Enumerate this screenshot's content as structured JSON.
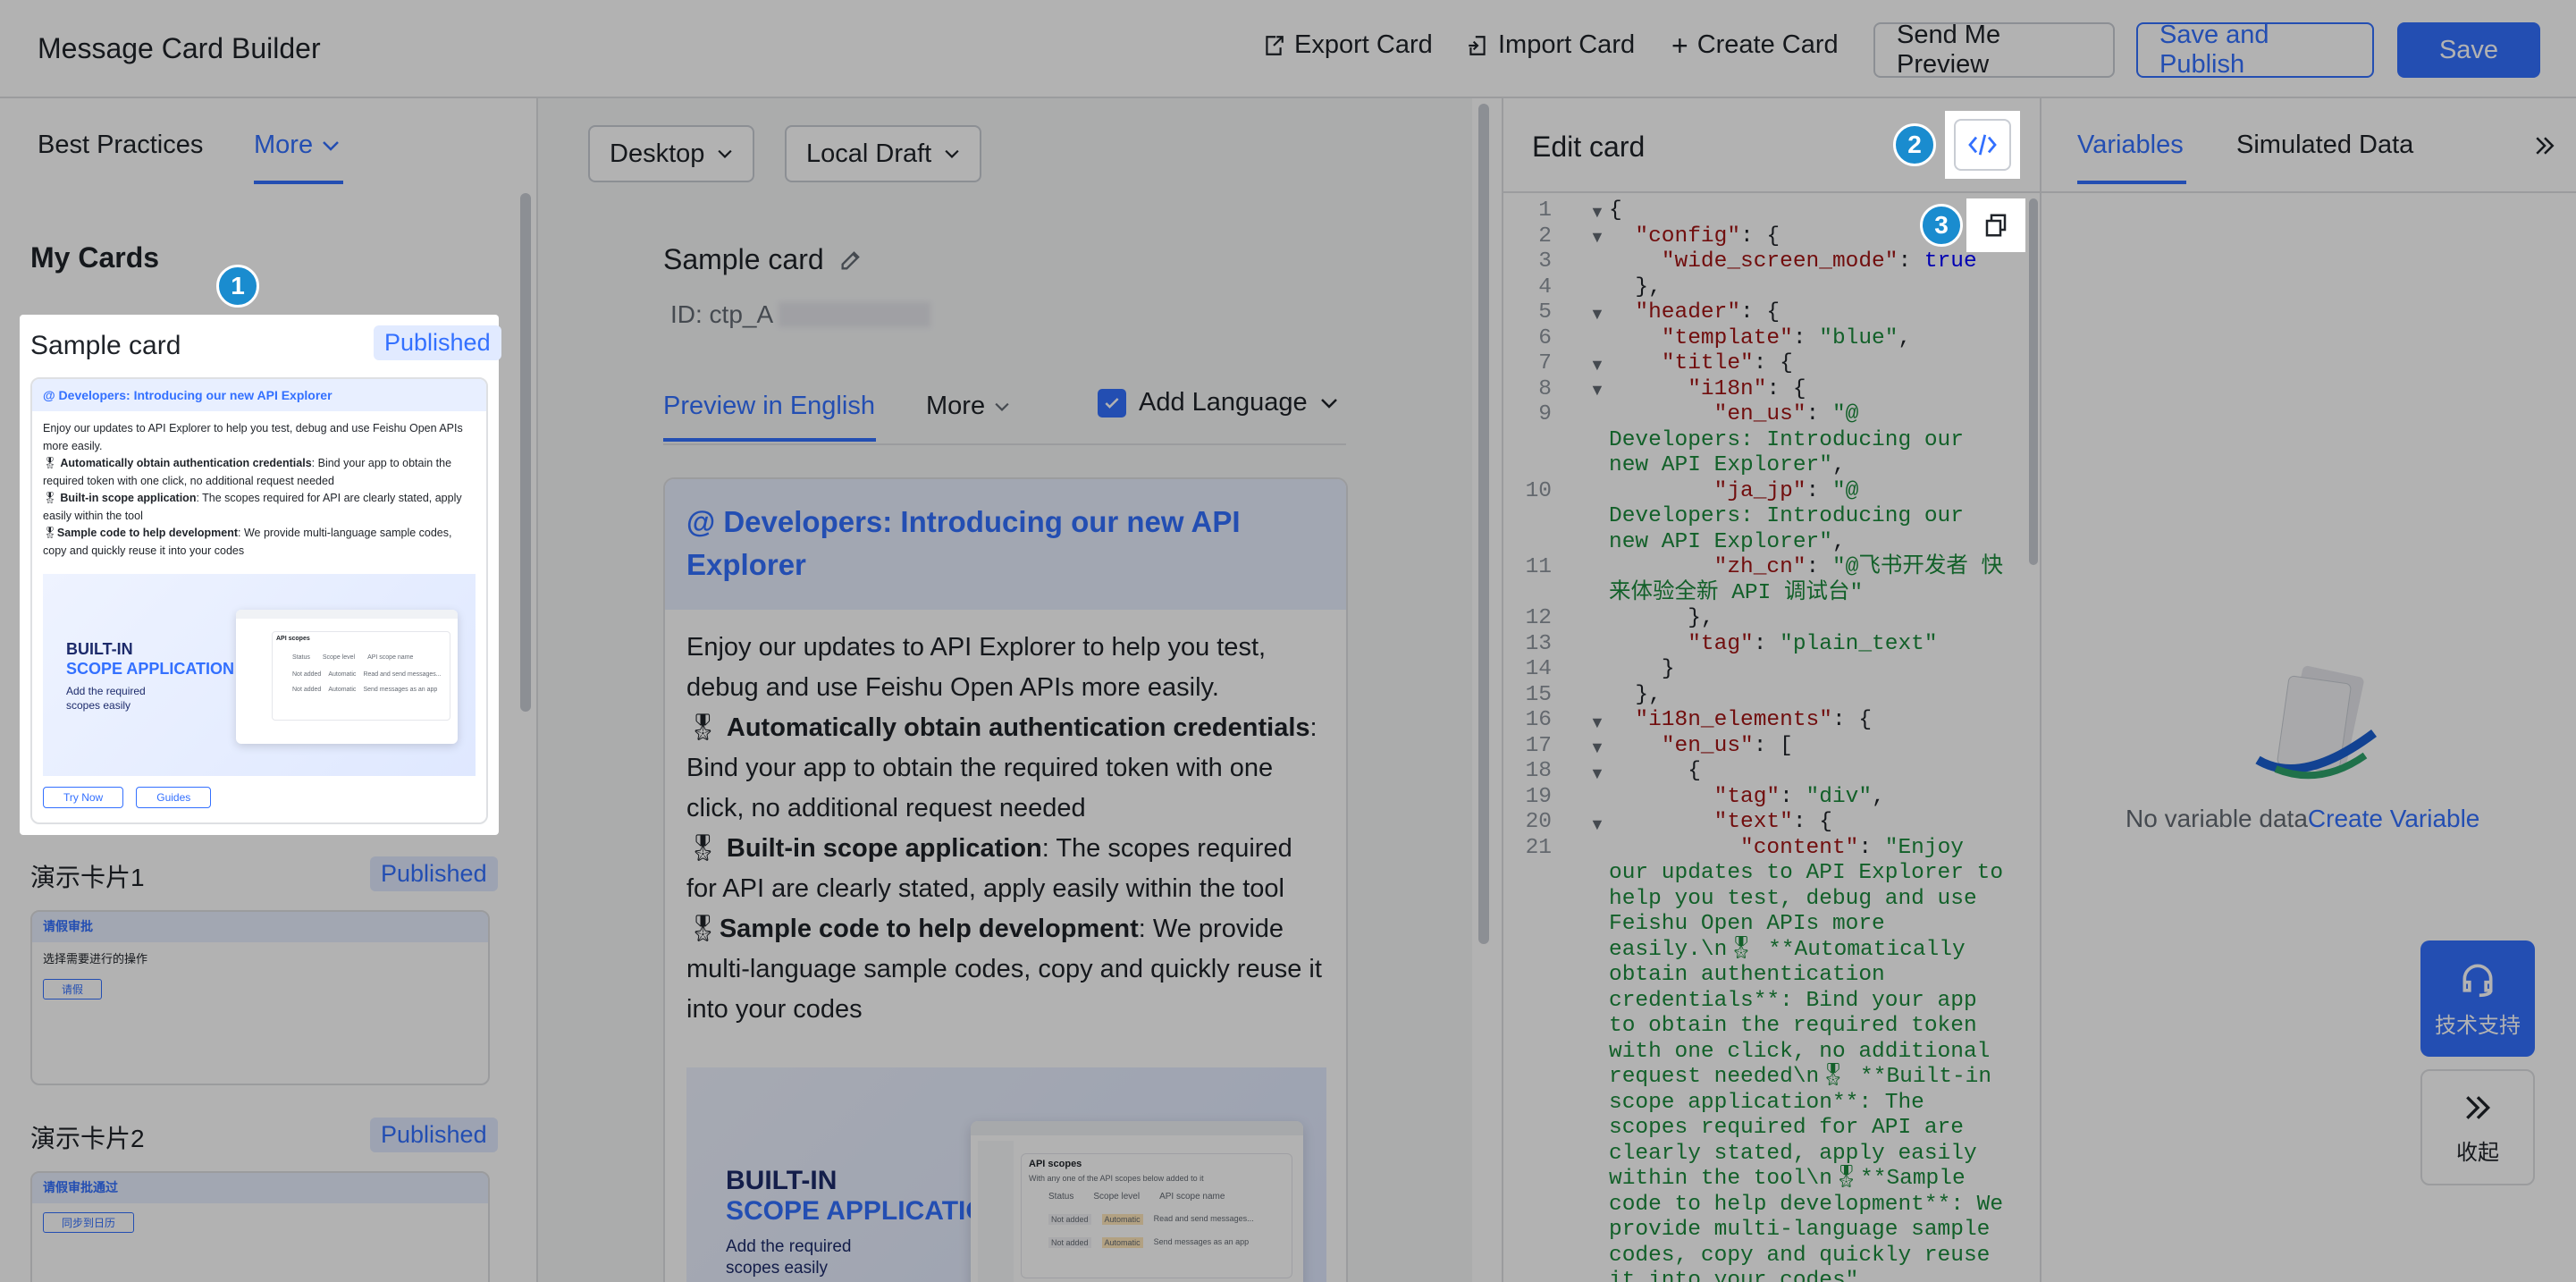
{
  "app": {
    "title": "Message Card Builder"
  },
  "toolbar": {
    "export": "Export Card",
    "import": "Import Card",
    "create": "Create Card",
    "send_preview": "Send Me Preview",
    "save_publish": "Save and Publish",
    "save": "Save"
  },
  "left": {
    "tabs": [
      "Best Practices",
      "More"
    ],
    "section_title": "My Cards",
    "cards": [
      {
        "name": "Sample card",
        "status": "Published"
      },
      {
        "name": "演示卡片1",
        "status": "Published",
        "header": "请假审批",
        "body": "选择需要进行的操作",
        "button": "请假"
      },
      {
        "name": "演示卡片2",
        "status": "Published",
        "header": "请假审批通过",
        "button": "同步到日历"
      }
    ],
    "thumb": {
      "header": "@ Developers: Introducing our new API Explorer",
      "intro": "Enjoy our updates to API Explorer to help you test, debug and use Feishu Open APIs more easily.",
      "b1_title": "Automatically obtain authentication credentials",
      "b1_text": ": Bind your app to obtain the required token with one click, no additional request needed",
      "b2_title": "Built-in scope application",
      "b2_text": ": The scopes required for API are clearly stated, apply easily within the tool",
      "b3_title": "Sample code to help development",
      "b3_text": ": We provide multi-language sample codes, copy and quickly reuse it into your codes",
      "btn1": "Try Now",
      "btn2": "Guides"
    }
  },
  "banner": {
    "line1": "BUILT-IN",
    "line2": "SCOPE APPLICATION",
    "line3": "Add the required",
    "line4": "scopes easily",
    "window_title": "API scopes",
    "window_sub": "With any one of the API scopes below added to it",
    "col_status": "Status",
    "col_level": "Scope level",
    "col_name": "API scope name",
    "row_status": "Not added",
    "row_level": "Automatic",
    "row1": "Read and send messages...",
    "row2": "Send messages as an app"
  },
  "middle": {
    "device": "Desktop",
    "draft": "Local Draft",
    "card_title": "Sample card",
    "card_id": "ID: ctp_A",
    "tabs": {
      "preview": "Preview in English",
      "more": "More",
      "add_lang": "Add Language"
    },
    "preview": {
      "header": "@ Developers: Introducing our new API Explorer",
      "intro": "Enjoy our updates to API Explorer to help you test, debug and use Feishu Open APIs more easily.",
      "b1_title": "Automatically obtain authentication credentials",
      "b1_text": ": Bind your app to obtain the required token with one click, no additional request needed",
      "b2_title": "Built-in scope application",
      "b2_text": ": The scopes required for API are clearly stated, apply easily within the tool",
      "b3_title": "Sample code to help development",
      "b3_text": ": We provide multi-language sample codes, copy and quickly reuse it into your codes"
    }
  },
  "editor": {
    "title": "Edit card",
    "line_numbers": [
      "1",
      "2",
      "3",
      "4",
      "5",
      "6",
      "7",
      "8",
      "9",
      "10",
      "11",
      "12",
      "13",
      "14",
      "15",
      "16",
      "17",
      "18",
      "19",
      "20",
      "21"
    ]
  },
  "right": {
    "tabs": [
      "Variables",
      "Simulated Data"
    ],
    "empty_text": "No variable data",
    "create_link": "Create Variable",
    "support": "技术支持",
    "collapse": "收起"
  },
  "markers": [
    "1",
    "2",
    "3"
  ],
  "colors": {
    "accent": "#3370ff",
    "marker": "#1a8ccf",
    "code_key": "#a31515",
    "code_string": "#1b8a3c",
    "code_bool": "#0000ff"
  }
}
